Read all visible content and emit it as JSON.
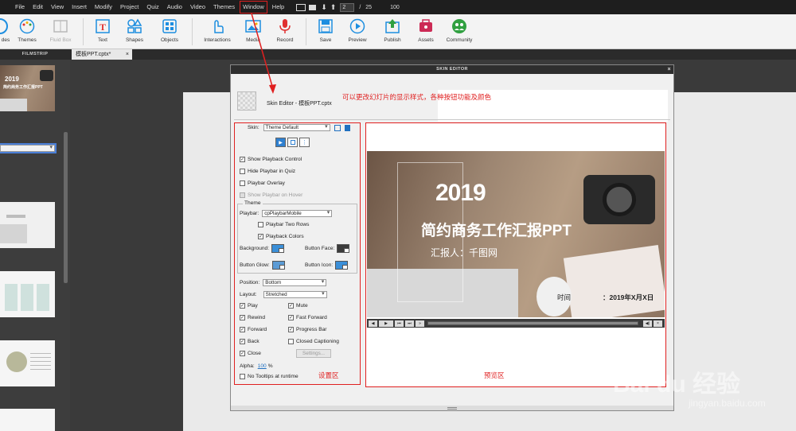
{
  "menubar": {
    "items": [
      "File",
      "Edit",
      "View",
      "Insert",
      "Modify",
      "Project",
      "Quiz",
      "Audio",
      "Video",
      "Themes",
      "Window",
      "Help"
    ],
    "page_current": "2",
    "page_separator": "/",
    "page_total": "25",
    "zoom": "100"
  },
  "toolbar": {
    "slides": "des",
    "themes": "Themes",
    "fluid_box": "Fluid Box",
    "text": "Text",
    "shapes": "Shapes",
    "objects": "Objects",
    "interactions": "Interactions",
    "media": "Media",
    "record": "Record",
    "save": "Save",
    "preview": "Preview",
    "publish": "Publish",
    "assets": "Assets",
    "community": "Community"
  },
  "filmstrip": {
    "header": "FILMSTRIP",
    "thumb1_title": "简约商务工作汇报PPT",
    "thumb1_year": "2019"
  },
  "document": {
    "tab_label": "模板PPT.cptx*",
    "tab_close": "×"
  },
  "dialog": {
    "title": "SKIN EDITOR",
    "close": "×",
    "subtitle": "Skin Editor - 模板PPT.cptx",
    "skin_label": "Skin:",
    "skin_value": "Theme Default",
    "show_playback": "Show Playback Control",
    "hide_playbar_quiz": "Hide Playbar in Quiz",
    "playbar_overlay": "Playbar Overlay",
    "show_playbar_hover": "Show Playbar on Hover",
    "theme_legend": "Theme",
    "playbar_label": "Playbar:",
    "playbar_value": "cpPlaybarMobile",
    "playbar_two_rows": "Playbar Two Rows",
    "playbar_colors": "Playback Colors",
    "background": "Background:",
    "button_face": "Button Face:",
    "button_glow": "Button Glow:",
    "button_icon": "Button Icon:",
    "position_label": "Position:",
    "position_value": "Bottom",
    "layout_label": "Layout:",
    "layout_value": "Stretched",
    "play": "Play",
    "mute": "Mute",
    "rewind": "Rewind",
    "fast_forward": "Fast Forward",
    "forward": "Forward",
    "progress_bar": "Progress Bar",
    "back": "Back",
    "closed_captioning": "Closed Captioning",
    "close_label": "Close",
    "settings_button": "Settings...",
    "alpha_label": "Alpha:",
    "alpha_value": "100",
    "alpha_unit": "%",
    "no_tooltips": "No Tooltips at runtime"
  },
  "annotations": {
    "header_note": "可以更改幻灯片的显示样式，各种按钮功能及颜色",
    "settings_area": "设置区",
    "preview_area": "预览区"
  },
  "preview": {
    "year": "2019",
    "title": "简约商务工作汇报PPT",
    "reporter": "汇报人：千图网",
    "time_label": "时间",
    "date": "：2019年X月X日"
  },
  "colors": {
    "accent_red": "#e02020",
    "menubar_bg": "#1e1e1e",
    "toolbar_bg": "#f3f3f3",
    "swatch_background": "#3b8fd8",
    "swatch_face": "#3b3b3b",
    "swatch_glow": "#5b9bd5",
    "swatch_icon": "#3b8fd8"
  },
  "watermark": {
    "brand": "Bai du 经验",
    "url": "jingyan.baidu.com"
  }
}
